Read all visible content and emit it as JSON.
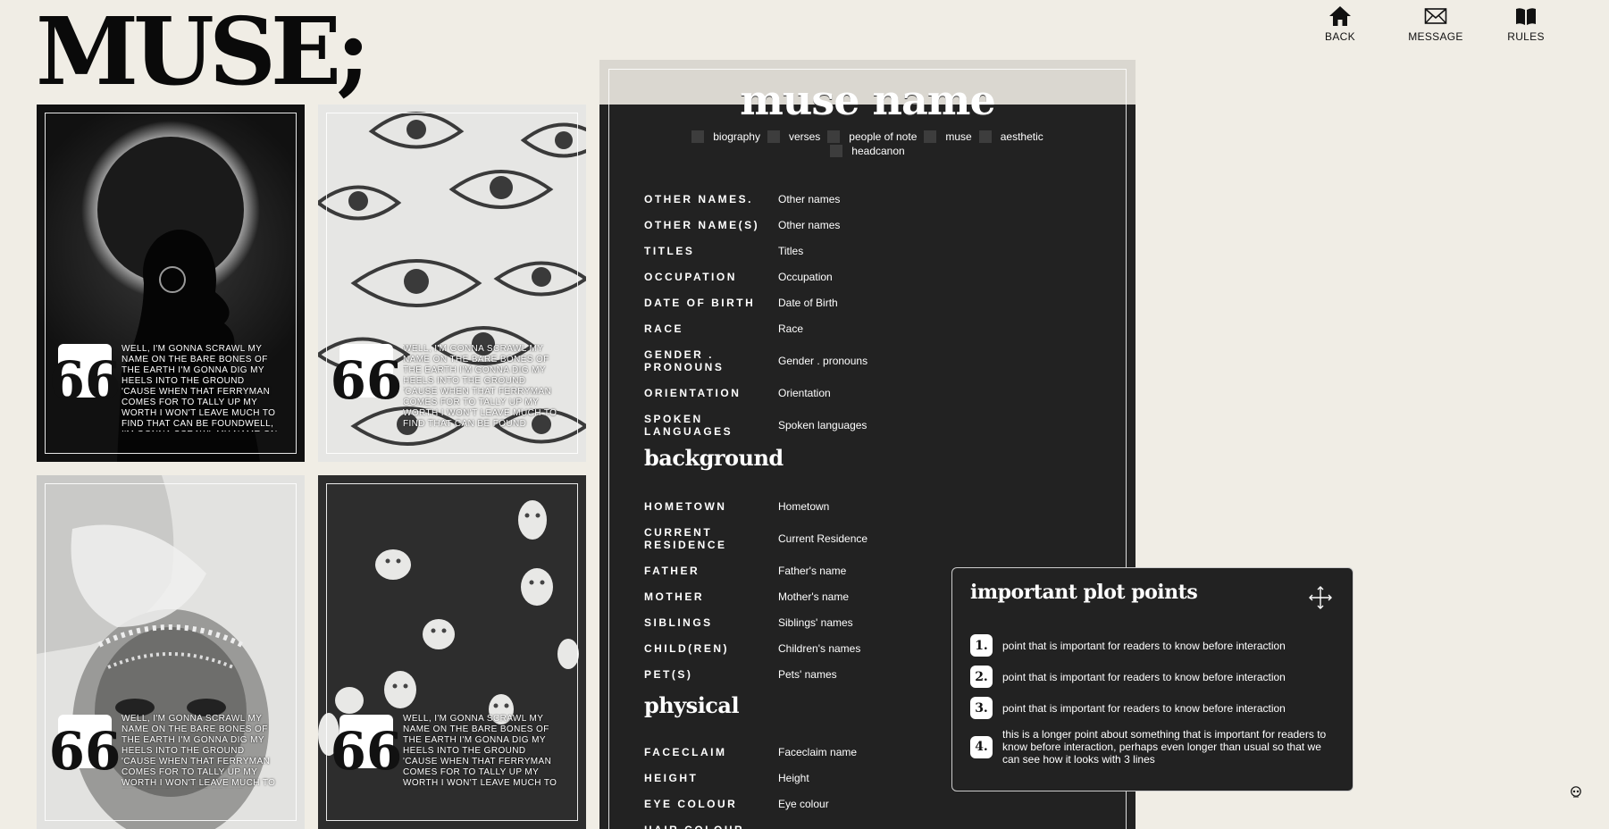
{
  "logo": "MUSE;",
  "nav": {
    "back": "BACK",
    "message": "MESSAGE",
    "rules": "RULES"
  },
  "gallery": {
    "quote_mark": "66",
    "quotes": [
      "WELL, I'M GONNA SCRAWL MY NAME ON THE BARE BONES OF THE EARTH I'M GONNA DIG MY HEELS INTO THE GROUND 'CAUSE WHEN THAT FERRYMAN COMES FOR TO TALLY UP MY WORTH I WON'T LEAVE MUCH TO FIND THAT CAN BE FOUNDWELL, I'M GONNA SCRAWL MY NAME ON THE BARE BONES OF THE EARTH",
      "WELL, I'M GONNA SCRAWL MY NAME ON THE BARE BONES OF THE EARTH I'M GONNA DIG MY HEELS INTO THE GROUND 'CAUSE WHEN THAT FERRYMAN COMES FOR TO TALLY UP MY WORTH I WON'T LEAVE MUCH TO FIND THAT CAN BE FOUND",
      "WELL, I'M GONNA SCRAWL MY NAME ON THE BARE BONES OF THE EARTH I'M GONNA DIG MY HEELS INTO THE GROUND 'CAUSE WHEN THAT FERRYMAN COMES FOR TO TALLY UP MY WORTH I WON'T LEAVE MUCH TO FIND THAT CAN BE FOUND",
      "WELL, I'M GONNA SCRAWL MY NAME ON THE BARE BONES OF THE EARTH I'M GONNA DIG MY HEELS INTO THE GROUND 'CAUSE WHEN THAT FERRYMAN COMES FOR TO TALLY UP MY WORTH I WON'T LEAVE MUCH TO FIND THAT CAN BE FOUND"
    ]
  },
  "profile": {
    "name": "muse name",
    "tabs": [
      "biography",
      "verses",
      "people of note",
      "muse",
      "aesthetic",
      "headcanon"
    ],
    "basics": [
      {
        "key": "OTHER NAMES.",
        "value": "Other names"
      },
      {
        "key": "OTHER NAME(S)",
        "value": "Other names"
      },
      {
        "key": "TITLES",
        "value": "Titles"
      },
      {
        "key": "OCCUPATION",
        "value": "Occupation"
      },
      {
        "key": "DATE OF BIRTH",
        "value": "Date of Birth"
      },
      {
        "key": "RACE",
        "value": "Race"
      },
      {
        "key": "GENDER . PRONOUNS",
        "value": "Gender . pronouns"
      },
      {
        "key": "ORIENTATION",
        "value": "Orientation"
      },
      {
        "key": "SPOKEN LANGUAGES",
        "value": "Spoken languages"
      }
    ],
    "background_title": "background",
    "background": [
      {
        "key": "HOMETOWN",
        "value": "Hometown"
      },
      {
        "key": "CURRENT RESIDENCE",
        "value": "Current Residence"
      },
      {
        "key": "FATHER",
        "value": "Father's name"
      },
      {
        "key": "MOTHER",
        "value": "Mother's name"
      },
      {
        "key": "SIBLINGS",
        "value": "Siblings' names"
      },
      {
        "key": "CHILD(REN)",
        "value": "Children's names"
      },
      {
        "key": "PET(S)",
        "value": "Pets' names"
      }
    ],
    "physical_title": "physical",
    "physical": [
      {
        "key": "FACECLAIM",
        "value": "Faceclaim name"
      },
      {
        "key": "HEIGHT",
        "value": "Height"
      },
      {
        "key": "EYE COLOUR",
        "value": "Eye colour"
      },
      {
        "key": "HAIR COLOUR",
        "value": ""
      }
    ]
  },
  "plot_points": {
    "title": "important plot points",
    "items": [
      {
        "num": "1.",
        "text": "point that is important for readers to know before interaction"
      },
      {
        "num": "2.",
        "text": "point that is important for readers to know before interaction"
      },
      {
        "num": "3.",
        "text": "point that is important for readers to know before interaction"
      },
      {
        "num": "4.",
        "text": "this is a longer point about something that is important for readers to know before interaction, perhaps even longer than usual so that we can see how it looks with 3 lines"
      }
    ]
  },
  "colors": {
    "page_bg": "#f0ede5",
    "panel_bg": "#222222",
    "accent_light": "#dad7d0"
  }
}
